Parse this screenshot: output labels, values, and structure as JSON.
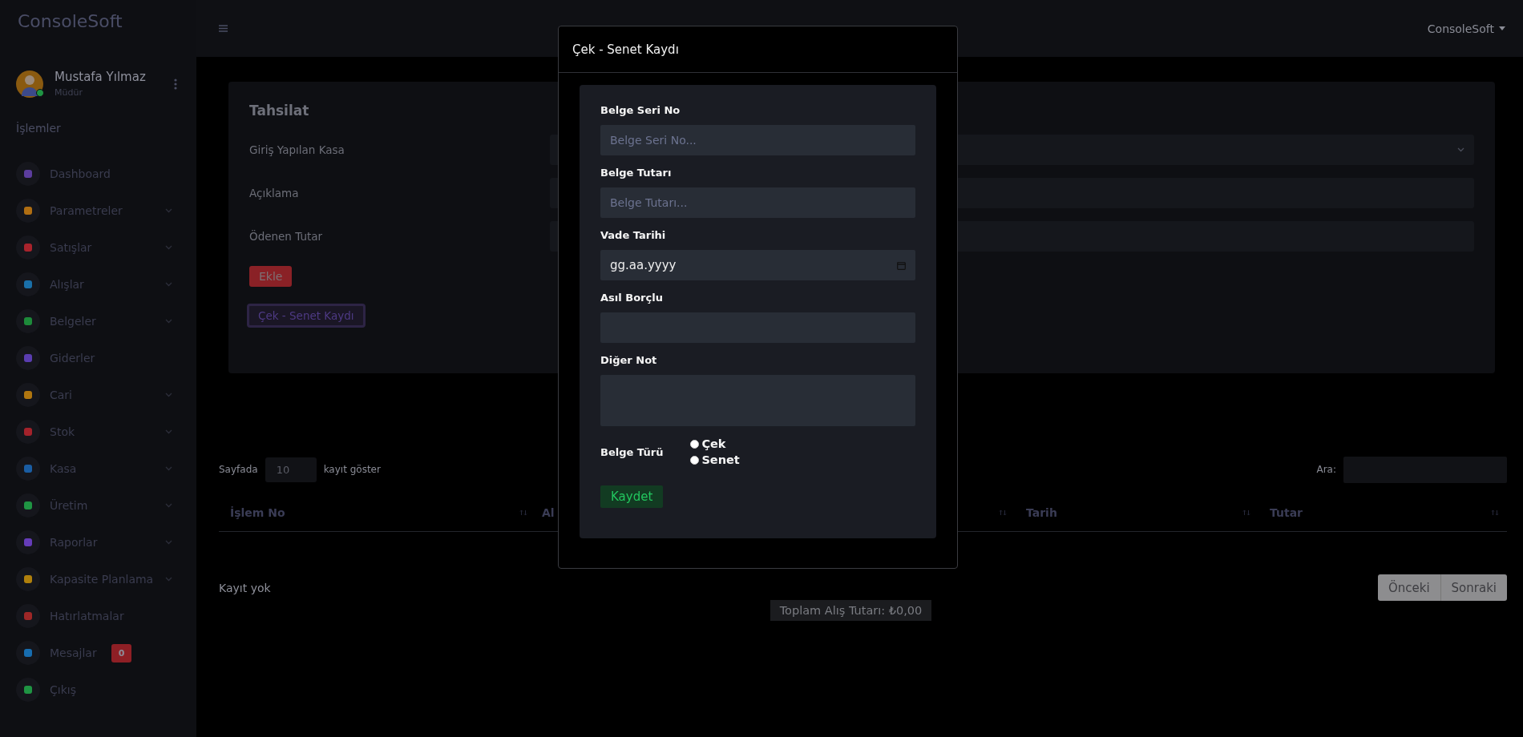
{
  "brand": "ConsoleSoft",
  "topbar": {
    "account": "ConsoleSoft"
  },
  "user": {
    "name": "Mustafa Yılmaz",
    "role": "Müdür",
    "online": true
  },
  "sidebar": {
    "heading": "İşlemler",
    "items": [
      {
        "label": "Dashboard",
        "color": "#5c3d9e",
        "has_submenu": false
      },
      {
        "label": "Parametreler",
        "color": "#b06e12",
        "has_submenu": true
      },
      {
        "label": "Satışlar",
        "color": "#a8232c",
        "has_submenu": true
      },
      {
        "label": "Alışlar",
        "color": "#1a6fa8",
        "has_submenu": true
      },
      {
        "label": "Belgeler",
        "color": "#1d8a3a",
        "has_submenu": true
      },
      {
        "label": "Giderler",
        "color": "#5a3db0",
        "has_submenu": false
      },
      {
        "label": "Cari",
        "color": "#b0760f",
        "has_submenu": true
      },
      {
        "label": "Stok",
        "color": "#a3222b",
        "has_submenu": true
      },
      {
        "label": "Kasa",
        "color": "#1a5da3",
        "has_submenu": true
      },
      {
        "label": "Üretim",
        "color": "#1f9443",
        "has_submenu": true
      },
      {
        "label": "Raporlar",
        "color": "#653cb8",
        "has_submenu": true
      },
      {
        "label": "Kapasite Planlama",
        "color": "#b0800c",
        "has_submenu": true
      },
      {
        "label": "Hatırlatmalar",
        "color": "#9e2727",
        "has_submenu": false
      },
      {
        "label": "Mesajlar",
        "color": "#176db0",
        "has_submenu": false,
        "badge": "0"
      },
      {
        "label": "Çıkış",
        "color": "#1f9443",
        "has_submenu": false
      }
    ]
  },
  "card": {
    "title": "Tahsilat",
    "fields": [
      {
        "label": "Giriş Yapılan Kasa",
        "kind": "select"
      },
      {
        "label": "Açıklama",
        "kind": "text"
      },
      {
        "label": "Ödenen Tutar",
        "kind": "text"
      }
    ],
    "add_button": "Ekle",
    "check_button": "Çek - Senet Kaydı"
  },
  "table": {
    "length_prefix": "Sayfada",
    "page_size": "10",
    "length_suffix": "kayıt göster",
    "search_label": "Ara:",
    "columns": [
      "İşlem No",
      "Al",
      "Tarih",
      "Tutar"
    ],
    "empty_text": "Kayıt yok",
    "total": "Toplam Alış Tutarı: ₺0,00",
    "pagination": [
      "Önceki",
      "Sonraki"
    ]
  },
  "modal": {
    "title": "Çek - Senet Kaydı",
    "fields": [
      {
        "label": "Belge Seri No",
        "kind": "text",
        "placeholder": "Belge Seri No..."
      },
      {
        "label": "Belge Tutarı",
        "kind": "text",
        "placeholder": "Belge Tutarı..."
      },
      {
        "label": "Vade Tarihi",
        "kind": "date",
        "value": "gg.aa.yyyy"
      },
      {
        "label": "Asıl Borçlu",
        "kind": "text"
      },
      {
        "label": "Diğer Not",
        "kind": "textarea"
      }
    ],
    "type_label": "Belge Türü",
    "types": [
      {
        "label": "Çek",
        "selected": false
      },
      {
        "label": "Senet",
        "selected": false
      }
    ],
    "save_button": "Kaydet"
  }
}
